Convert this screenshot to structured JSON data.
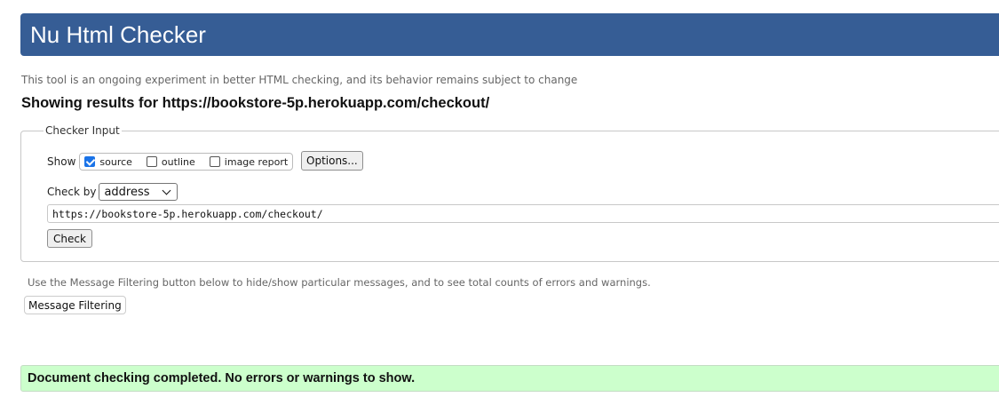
{
  "header": {
    "title": "Nu Html Checker"
  },
  "intro": "This tool is an ongoing experiment in better HTML checking, and its behavior remains subject to change",
  "results": {
    "prefix": "Showing results for",
    "url": "https://bookstore-5p.herokuapp.com/checkout/"
  },
  "checker_input": {
    "legend": "Checker Input",
    "show_label": "Show",
    "show_options": [
      {
        "label": "source",
        "checked": true
      },
      {
        "label": "outline",
        "checked": false
      },
      {
        "label": "image report",
        "checked": false
      }
    ],
    "options_button": "Options...",
    "check_by_label": "Check by",
    "check_by_value": "address",
    "url_value": "https://bookstore-5p.herokuapp.com/checkout/",
    "check_button": "Check"
  },
  "filtering": {
    "note": "Use the Message Filtering button below to hide/show particular messages, and to see total counts of errors and warnings.",
    "button": "Message Filtering"
  },
  "status": {
    "message": "Document checking completed. No errors or warnings to show."
  },
  "colors": {
    "header_bg": "#365d95",
    "success_bg": "#ccffcc",
    "checkbox_checked": "#1a73e8"
  }
}
